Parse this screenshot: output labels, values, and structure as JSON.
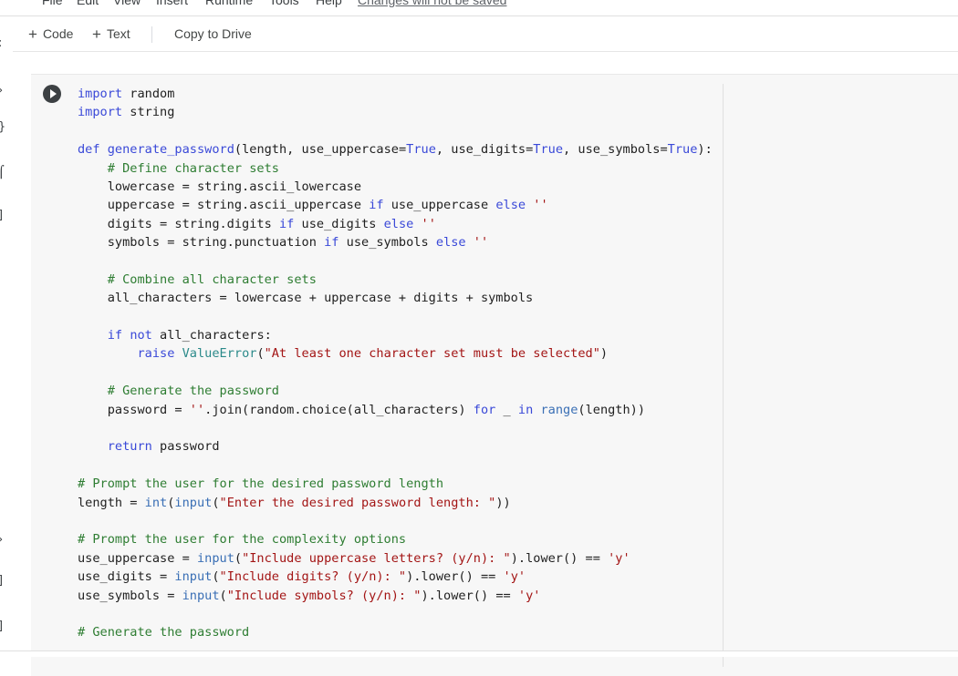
{
  "menu": {
    "items": [
      "File",
      "Edit",
      "View",
      "Insert",
      "Runtime",
      "Tools",
      "Help"
    ],
    "warning": "Changes will not be saved"
  },
  "toolbar": {
    "add_code_label": "Code",
    "add_text_label": "Text",
    "copy_label": "Copy to Drive",
    "plus_glyph": "+"
  },
  "rail": {
    "glyphs": [
      ":",
      "›",
      "}",
      "⌠",
      "]",
      "›",
      "]",
      "]"
    ]
  },
  "cell": {
    "lines": [
      [
        [
          "kw",
          "import"
        ],
        [
          "op",
          " random"
        ]
      ],
      [
        [
          "kw",
          "import"
        ],
        [
          "op",
          " string"
        ]
      ],
      [],
      [
        [
          "kw",
          "def"
        ],
        [
          "op",
          " "
        ],
        [
          "fn",
          "generate_password"
        ],
        [
          "op",
          "(length, use_uppercase"
        ],
        [
          "op",
          "="
        ],
        [
          "tr",
          "True"
        ],
        [
          "op",
          ", use_digits"
        ],
        [
          "op",
          "="
        ],
        [
          "tr",
          "True"
        ],
        [
          "op",
          ", use_symbols"
        ],
        [
          "op",
          "="
        ],
        [
          "tr",
          "True"
        ],
        [
          "op",
          "):"
        ]
      ],
      [
        [
          "op",
          "    "
        ],
        [
          "cm",
          "# Define character sets"
        ]
      ],
      [
        [
          "op",
          "    lowercase = string.ascii_lowercase"
        ]
      ],
      [
        [
          "op",
          "    uppercase = string.ascii_uppercase "
        ],
        [
          "kw",
          "if"
        ],
        [
          "op",
          " use_uppercase "
        ],
        [
          "kw",
          "else"
        ],
        [
          "op",
          " "
        ],
        [
          "st",
          "''"
        ]
      ],
      [
        [
          "op",
          "    digits = string.digits "
        ],
        [
          "kw",
          "if"
        ],
        [
          "op",
          " use_digits "
        ],
        [
          "kw",
          "else"
        ],
        [
          "op",
          " "
        ],
        [
          "st",
          "''"
        ]
      ],
      [
        [
          "op",
          "    symbols = string.punctuation "
        ],
        [
          "kw",
          "if"
        ],
        [
          "op",
          " use_symbols "
        ],
        [
          "kw",
          "else"
        ],
        [
          "op",
          " "
        ],
        [
          "st",
          "''"
        ]
      ],
      [],
      [
        [
          "op",
          "    "
        ],
        [
          "cm",
          "# Combine all character sets"
        ]
      ],
      [
        [
          "op",
          "    all_characters = lowercase + uppercase + digits + symbols"
        ]
      ],
      [],
      [
        [
          "op",
          "    "
        ],
        [
          "kw",
          "if"
        ],
        [
          "op",
          " "
        ],
        [
          "kw",
          "not"
        ],
        [
          "op",
          " all_characters:"
        ]
      ],
      [
        [
          "op",
          "        "
        ],
        [
          "kw",
          "raise"
        ],
        [
          "op",
          " "
        ],
        [
          "ex",
          "ValueError"
        ],
        [
          "op",
          "("
        ],
        [
          "st",
          "\"At least one character set must be selected\""
        ],
        [
          "op",
          ")"
        ]
      ],
      [],
      [
        [
          "op",
          "    "
        ],
        [
          "cm",
          "# Generate the password"
        ]
      ],
      [
        [
          "op",
          "    password = "
        ],
        [
          "st",
          "''"
        ],
        [
          "op",
          ".join(random.choice(all_characters) "
        ],
        [
          "kw",
          "for"
        ],
        [
          "op",
          " _ "
        ],
        [
          "kw",
          "in"
        ],
        [
          "op",
          " "
        ],
        [
          "bi",
          "range"
        ],
        [
          "op",
          "(length))"
        ]
      ],
      [],
      [
        [
          "op",
          "    "
        ],
        [
          "kw",
          "return"
        ],
        [
          "op",
          " password"
        ]
      ],
      [],
      [
        [
          "cm",
          "# Prompt the user for the desired password length"
        ]
      ],
      [
        [
          "op",
          "length = "
        ],
        [
          "bi",
          "int"
        ],
        [
          "op",
          "("
        ],
        [
          "bi",
          "input"
        ],
        [
          "op",
          "("
        ],
        [
          "st",
          "\"Enter the desired password length: \""
        ],
        [
          "op",
          "))"
        ]
      ],
      [],
      [
        [
          "cm",
          "# Prompt the user for the complexity options"
        ]
      ],
      [
        [
          "op",
          "use_uppercase = "
        ],
        [
          "bi",
          "input"
        ],
        [
          "op",
          "("
        ],
        [
          "st",
          "\"Include uppercase letters? (y/n): \""
        ],
        [
          "op",
          ").lower() == "
        ],
        [
          "st",
          "'y'"
        ]
      ],
      [
        [
          "op",
          "use_digits = "
        ],
        [
          "bi",
          "input"
        ],
        [
          "op",
          "("
        ],
        [
          "st",
          "\"Include digits? (y/n): \""
        ],
        [
          "op",
          ").lower() == "
        ],
        [
          "st",
          "'y'"
        ]
      ],
      [
        [
          "op",
          "use_symbols = "
        ],
        [
          "bi",
          "input"
        ],
        [
          "op",
          "("
        ],
        [
          "st",
          "\"Include symbols? (y/n): \""
        ],
        [
          "op",
          ").lower() == "
        ],
        [
          "st",
          "'y'"
        ]
      ],
      [],
      [
        [
          "cm",
          "# Generate the password"
        ]
      ]
    ]
  }
}
